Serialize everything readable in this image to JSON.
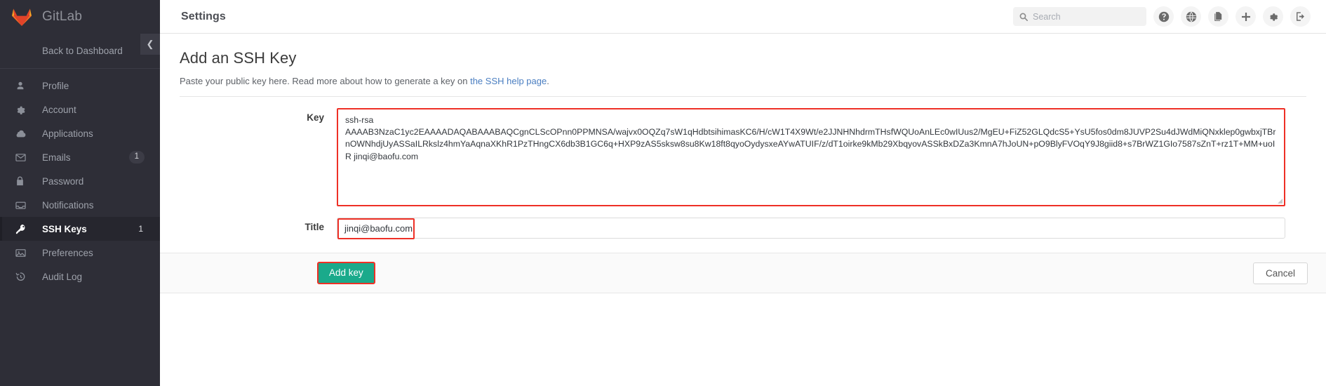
{
  "sidebar": {
    "brand": "GitLab",
    "collapse_icon": "chevron-left-icon",
    "back_to_dashboard": "Back to Dashboard",
    "items": [
      {
        "label": "Profile",
        "icon": "user-icon",
        "badge": "",
        "active": false
      },
      {
        "label": "Account",
        "icon": "gear-icon",
        "badge": "",
        "active": false
      },
      {
        "label": "Applications",
        "icon": "cloud-icon",
        "badge": "",
        "active": false
      },
      {
        "label": "Emails",
        "icon": "envelope-icon",
        "badge": "1",
        "active": false
      },
      {
        "label": "Password",
        "icon": "lock-icon",
        "badge": "",
        "active": false
      },
      {
        "label": "Notifications",
        "icon": "inbox-icon",
        "badge": "",
        "active": false
      },
      {
        "label": "SSH Keys",
        "icon": "key-icon",
        "badge": "1",
        "active": true
      },
      {
        "label": "Preferences",
        "icon": "image-icon",
        "badge": "",
        "active": false
      },
      {
        "label": "Audit Log",
        "icon": "history-icon",
        "badge": "",
        "active": false
      }
    ]
  },
  "topbar": {
    "title": "Settings",
    "search_placeholder": "Search",
    "search_value": "",
    "icons": [
      {
        "name": "help-icon",
        "glyph": "?"
      },
      {
        "name": "globe-icon",
        "glyph": "globe"
      },
      {
        "name": "copy-files-icon",
        "glyph": "files"
      },
      {
        "name": "plus-icon",
        "glyph": "+"
      },
      {
        "name": "gear-icon",
        "glyph": "gear"
      },
      {
        "name": "sign-out-icon",
        "glyph": "signout"
      }
    ]
  },
  "page": {
    "title": "Add an SSH Key",
    "description_before": "Paste your public key here. Read more about how to generate a key on ",
    "description_link": "the SSH help page",
    "description_after": "."
  },
  "form": {
    "key_label": "Key",
    "key_value": "ssh-rsa\nAAAAB3NzaC1yc2EAAAADAQABAAABAQCgnCLScOPnn0PPMNSA/wajvx0OQZq7sW1qHdbtsihimasKC6/H/cW1T4X9Wt/e2JJNHNhdrmTHsfWQUoAnLEc0wIUus2/MgEU+FiZ52GLQdcS5+YsU5fos0dm8JUVP2Su4dJWdMiQNxklep0gwbxjTBrnOWNhdjUyASSaILRkslz4hmYaAqnaXKhR1PzTHngCX6db3B1GC6q+HXP9zAS5sksw8su8Kw18ft8qyoOydysxeAYwATUIF/z/dT1oirke9kMb29XbqyovASSkBxDZa3KmnA7hJoUN+pO9BlyFVOqY9J8giid8+s7BrWZ1GIo7587sZnT+rz1T+MM+uoIR jinqi@baofu.com",
    "title_label": "Title",
    "title_value": "jinqi@baofu.com",
    "add_button": "Add key",
    "cancel_button": "Cancel"
  },
  "colors": {
    "sidebar_bg": "#2e2e37",
    "accent_green": "#1aaa8b",
    "highlight_red": "#ee3026",
    "link_blue": "#4a7ec1"
  }
}
